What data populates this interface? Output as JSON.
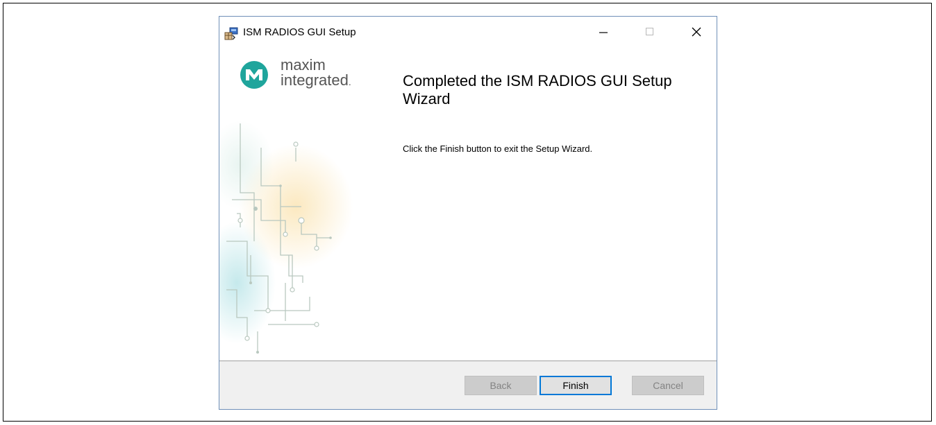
{
  "window": {
    "title": "ISM RADIOS GUI Setup",
    "controls": {
      "minimize_icon": "minimize-icon",
      "maximize_icon": "maximize-icon",
      "close_icon": "close-icon"
    }
  },
  "logo": {
    "line1": "maxim",
    "line2": "integrated",
    "trademark": ".",
    "mark_color": "#1fa59c"
  },
  "content": {
    "heading": "Completed the ISM RADIOS GUI Setup Wizard",
    "message": "Click the Finish button to exit the Setup Wizard."
  },
  "buttons": {
    "back": {
      "label": "Back",
      "enabled": false
    },
    "finish": {
      "label": "Finish",
      "enabled": true,
      "focused": true
    },
    "cancel": {
      "label": "Cancel",
      "enabled": false
    }
  },
  "colors": {
    "focus_border": "#0078d7",
    "footer_bg": "#f0f0f0",
    "dialog_border": "#6f8fb8"
  }
}
